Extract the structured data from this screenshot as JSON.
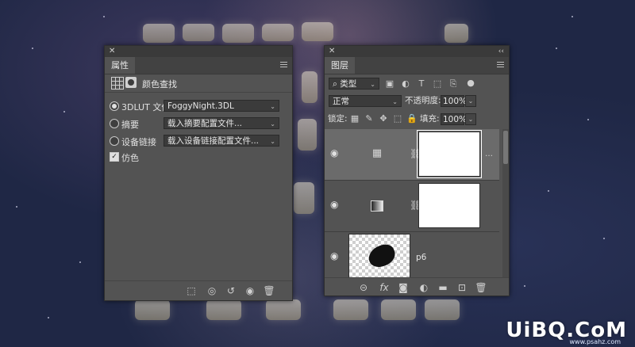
{
  "properties_panel": {
    "tab_label": "属性",
    "header_title": "颜色查找",
    "rows": [
      {
        "label": "3DLUT 文件",
        "value": "FoggyNight.3DL",
        "selected": true
      },
      {
        "label": "摘要",
        "value": "载入摘要配置文件...",
        "selected": false
      },
      {
        "label": "设备链接",
        "value": "载入设备链接配置文件...",
        "selected": false
      }
    ],
    "dither_label": "仿色",
    "dither_checked": true
  },
  "layers_panel": {
    "tab_label": "图层",
    "filter_kind": "类型",
    "blend_mode": "正常",
    "opacity_label": "不透明度:",
    "opacity_value": "100%",
    "lock_label": "锁定:",
    "fill_label": "填充:",
    "fill_value": "100%",
    "layers": [
      {
        "type": "color-lookup",
        "name": "",
        "selected": true
      },
      {
        "type": "gradient-map",
        "name": "",
        "selected": false
      },
      {
        "type": "pixel",
        "name": "p6",
        "selected": false
      }
    ]
  },
  "watermark": {
    "text": "UiBQ.CoM",
    "sub": "www.psahz.com"
  }
}
